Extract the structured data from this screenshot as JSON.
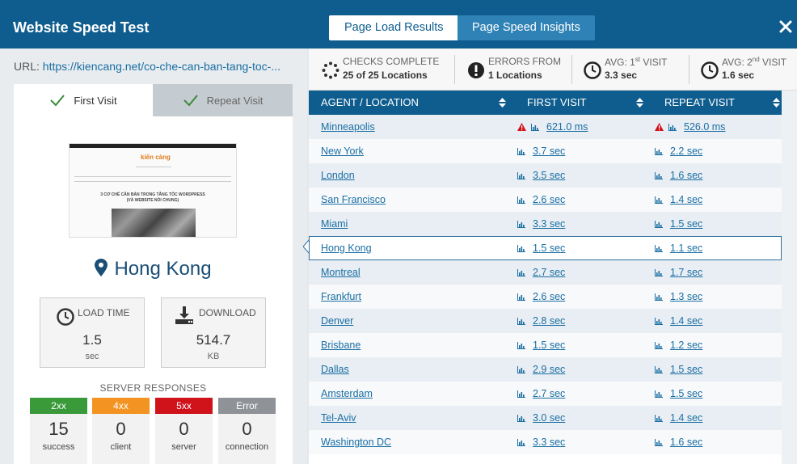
{
  "app": {
    "title": "Website Speed Test"
  },
  "tabs": [
    {
      "label": "Page Load Results",
      "active": true
    },
    {
      "label": "Page Speed Insights",
      "active": false
    }
  ],
  "url": {
    "label": "URL:",
    "value": "https://kiencang.net/co-che-can-ban-tang-toc-..."
  },
  "visit_tabs": [
    {
      "label": "First Visit",
      "active": true
    },
    {
      "label": "Repeat Visit",
      "active": false
    }
  ],
  "thumbnail": {
    "logo": "kiến càng",
    "heading_line1": "3 CƠ CHẾ CĂN BẢN TRONG TĂNG TỐC WORDPRESS",
    "heading_line2": "(VÀ WEBSITE NÓI CHUNG)"
  },
  "location": "Hong Kong",
  "metrics": {
    "load_time": {
      "label": "LOAD TIME",
      "value": "1.5",
      "unit": "sec"
    },
    "download": {
      "label": "DOWNLOAD",
      "value": "514.7",
      "unit": "KB"
    }
  },
  "server_responses": {
    "title": "SERVER RESPONSES",
    "items": [
      {
        "code": "2xx",
        "count": "15",
        "label": "success",
        "color": "#3a9a3a"
      },
      {
        "code": "4xx",
        "count": "0",
        "label": "client",
        "color": "#f39322"
      },
      {
        "code": "5xx",
        "count": "0",
        "label": "server",
        "color": "#d0121b"
      },
      {
        "code": "Error",
        "count": "0",
        "label": "connection",
        "color": "#8f9397"
      }
    ]
  },
  "stats": [
    {
      "icon": "spinner-icon",
      "title": "CHECKS COMPLETE",
      "value": "25 of 25 Locations"
    },
    {
      "icon": "exclamation-icon",
      "title": "ERRORS FROM",
      "value": "1 Locations"
    },
    {
      "icon": "clock-icon",
      "title_pre": "AVG: 1",
      "title_sup": "st",
      "title_post": " VISIT",
      "value": "3.3 sec"
    },
    {
      "icon": "clock-icon",
      "title_pre": "AVG: 2",
      "title_sup": "nd",
      "title_post": " VISIT",
      "value": "1.6 sec"
    }
  ],
  "table": {
    "headers": [
      "AGENT / LOCATION",
      "FIRST VISIT",
      "REPEAT VISIT"
    ],
    "rows": [
      {
        "location": "Minneapolis",
        "first": "621.0 ms",
        "repeat": "526.0 ms",
        "warn": true
      },
      {
        "location": "New York",
        "first": "3.7 sec",
        "repeat": "2.2 sec"
      },
      {
        "location": "London",
        "first": "3.5 sec",
        "repeat": "1.6 sec"
      },
      {
        "location": "San Francisco",
        "first": "2.6 sec",
        "repeat": "1.4 sec"
      },
      {
        "location": "Miami",
        "first": "3.3 sec",
        "repeat": "1.5 sec"
      },
      {
        "location": "Hong Kong",
        "first": "1.5 sec",
        "repeat": "1.1 sec",
        "selected": true
      },
      {
        "location": "Montreal",
        "first": "2.7 sec",
        "repeat": "1.7 sec"
      },
      {
        "location": "Frankfurt",
        "first": "2.6 sec",
        "repeat": "1.3 sec"
      },
      {
        "location": "Denver",
        "first": "2.8 sec",
        "repeat": "1.4 sec"
      },
      {
        "location": "Brisbane",
        "first": "1.5 sec",
        "repeat": "1.2 sec"
      },
      {
        "location": "Dallas",
        "first": "2.9 sec",
        "repeat": "1.5 sec"
      },
      {
        "location": "Amsterdam",
        "first": "2.7 sec",
        "repeat": "1.5 sec"
      },
      {
        "location": "Tel-Aviv",
        "first": "3.0 sec",
        "repeat": "1.4 sec"
      },
      {
        "location": "Washington DC",
        "first": "3.3 sec",
        "repeat": "1.6 sec"
      }
    ]
  },
  "colors": {
    "header": "#0e5d8e",
    "accent": "#1a6ea3",
    "warn": "#d0121b"
  }
}
